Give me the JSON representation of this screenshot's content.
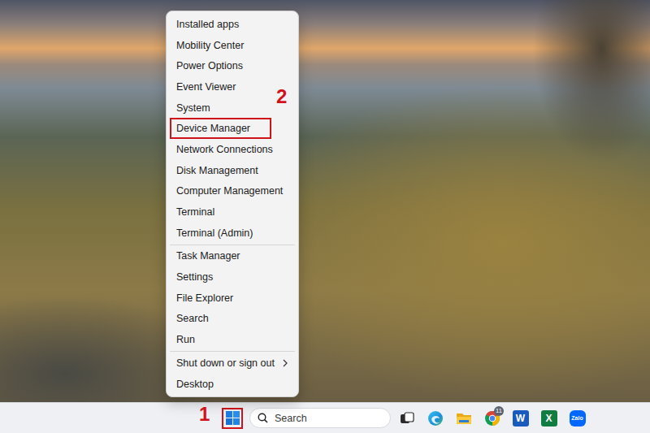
{
  "menu": {
    "groups": [
      [
        {
          "label": "Installed apps",
          "marked": false,
          "submenu": false
        },
        {
          "label": "Mobility Center",
          "marked": false,
          "submenu": false
        },
        {
          "label": "Power Options",
          "marked": false,
          "submenu": false
        },
        {
          "label": "Event Viewer",
          "marked": false,
          "submenu": false
        },
        {
          "label": "System",
          "marked": false,
          "submenu": false
        },
        {
          "label": "Device Manager",
          "marked": true,
          "submenu": false
        },
        {
          "label": "Network Connections",
          "marked": false,
          "submenu": false
        },
        {
          "label": "Disk Management",
          "marked": false,
          "submenu": false
        },
        {
          "label": "Computer Management",
          "marked": false,
          "submenu": false
        },
        {
          "label": "Terminal",
          "marked": false,
          "submenu": false
        },
        {
          "label": "Terminal (Admin)",
          "marked": false,
          "submenu": false
        }
      ],
      [
        {
          "label": "Task Manager",
          "marked": false,
          "submenu": false
        },
        {
          "label": "Settings",
          "marked": false,
          "submenu": false
        },
        {
          "label": "File Explorer",
          "marked": false,
          "submenu": false
        },
        {
          "label": "Search",
          "marked": false,
          "submenu": false
        },
        {
          "label": "Run",
          "marked": false,
          "submenu": false
        }
      ],
      [
        {
          "label": "Shut down or sign out",
          "marked": false,
          "submenu": true
        },
        {
          "label": "Desktop",
          "marked": false,
          "submenu": false
        }
      ]
    ],
    "step": "2"
  },
  "taskbar": {
    "start_button": {
      "marked": true,
      "step": "1"
    },
    "search": {
      "placeholder": "Search"
    },
    "apps": [
      {
        "kind": "taskview"
      },
      {
        "kind": "edge"
      },
      {
        "kind": "explorer"
      },
      {
        "kind": "chrome",
        "badge": "11"
      },
      {
        "kind": "word",
        "letter": "W"
      },
      {
        "kind": "excel",
        "letter": "X"
      },
      {
        "kind": "zalo",
        "letter": "Zalo"
      }
    ]
  }
}
